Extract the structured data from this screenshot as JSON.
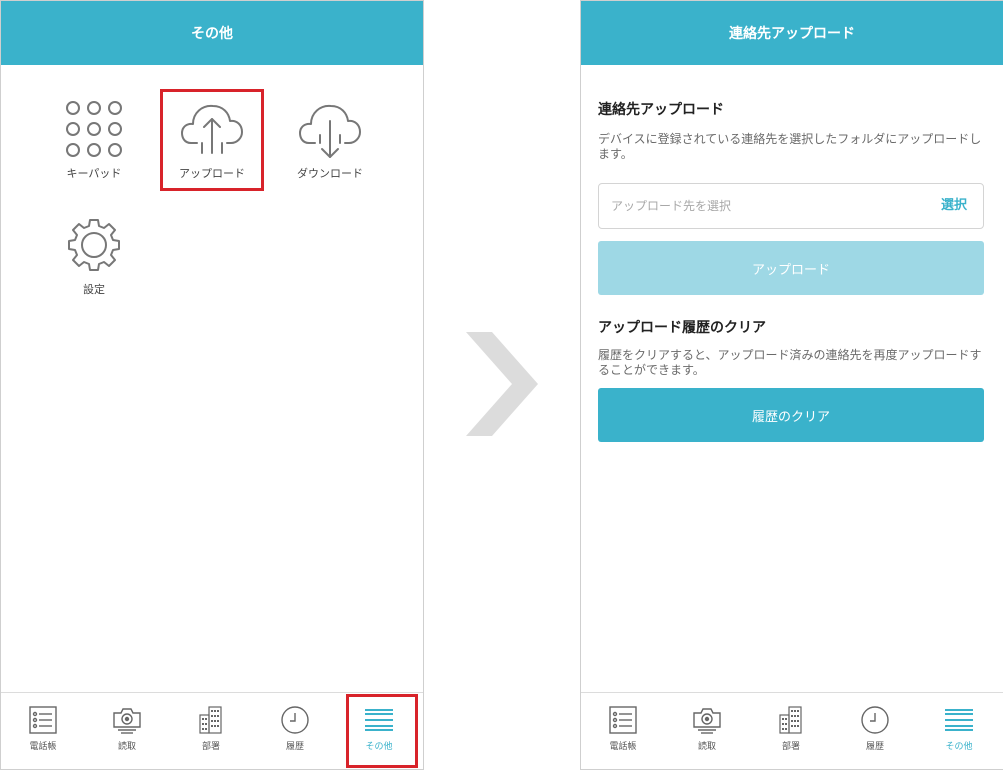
{
  "left_screen": {
    "header": {
      "title": "その他"
    },
    "menu": [
      {
        "label": "キーパッド",
        "icon": "keypad-icon"
      },
      {
        "label": "アップロード",
        "icon": "cloud-upload-icon",
        "highlighted": true
      },
      {
        "label": "ダウンロード",
        "icon": "cloud-download-icon"
      },
      {
        "label": "設定",
        "icon": "gear-icon"
      }
    ]
  },
  "right_screen": {
    "header": {
      "title": "連絡先アップロード"
    },
    "upload_section": {
      "title": "連絡先アップロード",
      "description": "デバイスに登録されている連絡先を選択したフォルダにアップロードします。",
      "input_placeholder": "アップロード先を選択",
      "select_label": "選択",
      "button_label": "アップロード"
    },
    "clear_section": {
      "title": "アップロード履歴のクリア",
      "description": "履歴をクリアすると、アップロード済みの連絡先を再度アップロードすることができます。",
      "button_label": "履歴のクリア"
    }
  },
  "bottom_nav": [
    {
      "label": "電話帳",
      "icon": "phonebook-icon"
    },
    {
      "label": "読取",
      "icon": "camera-icon"
    },
    {
      "label": "部署",
      "icon": "building-icon"
    },
    {
      "label": "履歴",
      "icon": "clock-icon"
    },
    {
      "label": "その他",
      "icon": "menu-icon",
      "active": true
    }
  ],
  "colors": {
    "accent": "#3ab2cb",
    "accent_disabled": "#9ed8e5",
    "highlight": "#d8232a",
    "arrow": "#dcdcdc"
  }
}
